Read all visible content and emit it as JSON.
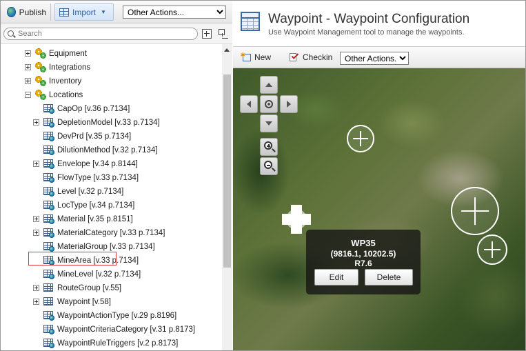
{
  "toolbar": {
    "publish_label": "Publish",
    "import_label": "Import",
    "other_actions": "Other Actions..."
  },
  "search": {
    "placeholder": "Search"
  },
  "tree": {
    "items": [
      {
        "label": "Equipment",
        "type": "group",
        "expander": "plus"
      },
      {
        "label": "Integrations",
        "type": "group",
        "expander": "plus"
      },
      {
        "label": "Inventory",
        "type": "group",
        "expander": "plus"
      },
      {
        "label": "Locations",
        "type": "group",
        "expander": "minus"
      },
      {
        "label": "CapOp [v.36 p.7134]",
        "type": "entity",
        "expander": "none"
      },
      {
        "label": "DepletionModel [v.33 p.7134]",
        "type": "entity",
        "expander": "plus"
      },
      {
        "label": "DevPrd [v.35 p.7134]",
        "type": "entity",
        "expander": "none"
      },
      {
        "label": "DilutionMethod [v.32 p.7134]",
        "type": "entity",
        "expander": "none"
      },
      {
        "label": "Envelope [v.34 p.8144]",
        "type": "entity",
        "expander": "plus"
      },
      {
        "label": "FlowType [v.33 p.7134]",
        "type": "entity",
        "expander": "none"
      },
      {
        "label": "Level [v.32 p.7134]",
        "type": "entity",
        "expander": "none"
      },
      {
        "label": "LocType [v.34 p.7134]",
        "type": "entity",
        "expander": "none"
      },
      {
        "label": "Material [v.35 p.8151]",
        "type": "entity",
        "expander": "plus"
      },
      {
        "label": "MaterialCategory [v.33 p.7134]",
        "type": "entity",
        "expander": "plus"
      },
      {
        "label": "MaterialGroup [v.33 p.7134]",
        "type": "entity",
        "expander": "none"
      },
      {
        "label": "MineArea [v.33 p.7134]",
        "type": "entity",
        "expander": "none"
      },
      {
        "label": "MineLevel [v.32 p.7134]",
        "type": "entity",
        "expander": "none"
      },
      {
        "label": "RouteGroup [v.55]",
        "type": "table",
        "expander": "plus"
      },
      {
        "label": "Waypoint [v.58]",
        "type": "table",
        "expander": "plus",
        "selected": true
      },
      {
        "label": "WaypointActionType [v.29 p.8196]",
        "type": "entity",
        "expander": "none"
      },
      {
        "label": "WaypointCriteriaCategory [v.31 p.8173]",
        "type": "entity",
        "expander": "none"
      },
      {
        "label": "WaypointRuleTriggers [v.2 p.8173]",
        "type": "entity",
        "expander": "none"
      }
    ]
  },
  "header": {
    "title": "Waypoint - Waypoint Configuration",
    "subtitle": "Use Waypoint Management tool to manage the waypoints."
  },
  "actions": {
    "new_label": "New",
    "checkin_label": "Checkin",
    "other_actions": "Other Actions..."
  },
  "popup": {
    "name": "WP35",
    "coords": "(9816.1, 10202.5)",
    "radius": "R7.6",
    "edit_label": "Edit",
    "delete_label": "Delete"
  },
  "colors": {
    "selection_outline": "#e0393e",
    "accent": "#2b5fa6"
  }
}
